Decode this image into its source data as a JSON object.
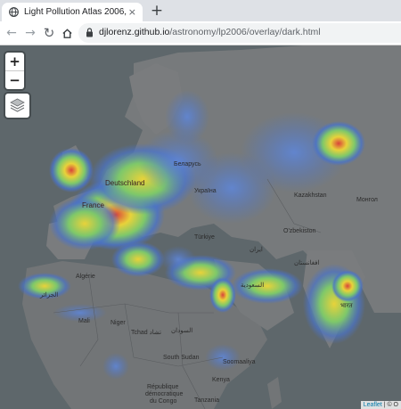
{
  "tab": {
    "title": "Light Pollution Atlas 2006, 2016 ...",
    "close_glyph": "×",
    "newtab_glyph": "+"
  },
  "toolbar": {
    "back_glyph": "←",
    "forward_glyph": "→",
    "reload_glyph": "↻",
    "url_host": "djlorenz.github.io",
    "url_path": "/astronomy/lp2006/overlay/dark.html"
  },
  "map": {
    "zoom_in": "+",
    "zoom_out": "−",
    "attribution_link": "Leaflet",
    "attribution_sep": " | © O",
    "labels": {
      "deutschland": "Deutschland",
      "france": "France",
      "kazakhstan": "Kazakhstan",
      "turkiye": "Türkiye",
      "algerie": "Algérie",
      "algerie_ar": "الجزائر",
      "mali": "Mali",
      "niger": "Niger",
      "tchad": "Tchad تشاد",
      "sudan": "السودان",
      "south_sudan": "South Sudan",
      "somaliya": "Soomaaliya",
      "drc1": "République",
      "drc2": "démocratique",
      "drc3": "du Congo",
      "uzbek": "O'zbekiston",
      "bharat": "भारत",
      "afghanistan": "افغانستان",
      "iran": "ایران",
      "belarus": "Беларусь",
      "ukraine": "Україна",
      "mongolia": "Монгол",
      "arab": "السعودية",
      "tanzania": "Tanzania",
      "kenya": "Kenya"
    }
  },
  "colors": {
    "ocean": "#5e676b",
    "land": "#777a7c",
    "glow_low": "#4a73c8",
    "glow_mid": "#7ec86a",
    "glow_high": "#e8d23a",
    "glow_peak": "#d9443a"
  }
}
